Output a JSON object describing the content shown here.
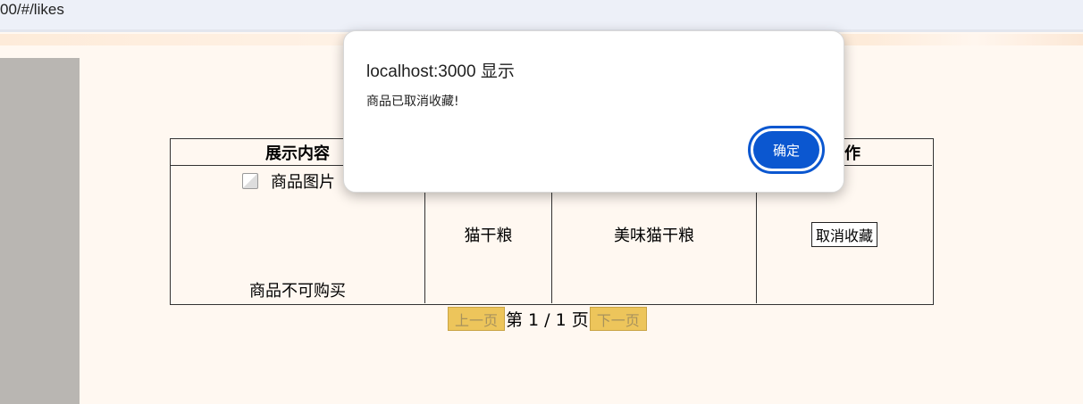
{
  "browser": {
    "url_fragment": "00/#/likes"
  },
  "table": {
    "headers": [
      "展示内容",
      "作"
    ],
    "row": {
      "image_alt": "商品图片",
      "buy_status": "商品不可购买",
      "name": "猫干粮",
      "description": "美味猫干粮",
      "action_label": "取消收藏"
    }
  },
  "pager": {
    "prev_label": "上一页",
    "page_info": "第 1 / 1 页",
    "next_label": "下一页"
  },
  "dialog": {
    "title": "localhost:3000 显示",
    "message": "商品已取消收藏!",
    "ok_label": "确定"
  },
  "colors": {
    "accent": "#0b57d0",
    "pager_button": "#edc55b",
    "page_bg": "#fff8f1"
  }
}
